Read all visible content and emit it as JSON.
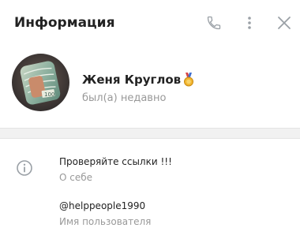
{
  "header": {
    "title": "Информация",
    "icons": [
      "phone-icon",
      "more-vertical-icon",
      "close-icon"
    ]
  },
  "profile": {
    "name": "Женя Круглов",
    "status": "был(а) недавно",
    "badge_icon": "medal-icon"
  },
  "info": {
    "icon": "info-icon",
    "bio_value": "Проверяйте ссылки !!!",
    "bio_label": "О себе",
    "username_value": "@helppeople1990",
    "username_label": "Имя пользователя"
  },
  "colors": {
    "title_text": "#222222",
    "secondary_text": "#999999",
    "icon_gray": "#9aa0a6",
    "divider_bg": "#f1f1f1",
    "medal_gold": "#f2b630"
  }
}
